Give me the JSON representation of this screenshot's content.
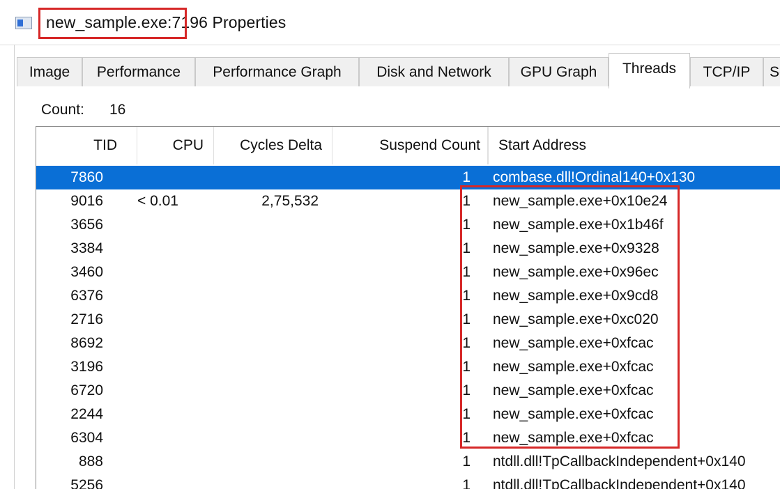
{
  "window": {
    "title": "new_sample.exe:7196 Properties"
  },
  "tabs": [
    {
      "label": "Image"
    },
    {
      "label": "Performance"
    },
    {
      "label": "Performance Graph"
    },
    {
      "label": "Disk and Network"
    },
    {
      "label": "GPU Graph"
    },
    {
      "label": "Threads",
      "active": true
    },
    {
      "label": "TCP/IP"
    },
    {
      "label": "Se"
    }
  ],
  "threads": {
    "count_label": "Count:",
    "count_value": "16",
    "columns": [
      "TID",
      "CPU",
      "Cycles Delta",
      "Suspend Count",
      "Start Address"
    ],
    "rows": [
      {
        "tid": "7860",
        "cpu": "",
        "cycles": "",
        "suspend": "1",
        "address": "combase.dll!Ordinal140+0x130",
        "selected": true
      },
      {
        "tid": "9016",
        "cpu": "< 0.01",
        "cycles": "2,75,532",
        "suspend": "1",
        "address": "new_sample.exe+0x10e24"
      },
      {
        "tid": "3656",
        "cpu": "",
        "cycles": "",
        "suspend": "1",
        "address": "new_sample.exe+0x1b46f"
      },
      {
        "tid": "3384",
        "cpu": "",
        "cycles": "",
        "suspend": "1",
        "address": "new_sample.exe+0x9328"
      },
      {
        "tid": "3460",
        "cpu": "",
        "cycles": "",
        "suspend": "1",
        "address": "new_sample.exe+0x96ec"
      },
      {
        "tid": "6376",
        "cpu": "",
        "cycles": "",
        "suspend": "1",
        "address": "new_sample.exe+0x9cd8"
      },
      {
        "tid": "2716",
        "cpu": "",
        "cycles": "",
        "suspend": "1",
        "address": "new_sample.exe+0xc020"
      },
      {
        "tid": "8692",
        "cpu": "",
        "cycles": "",
        "suspend": "1",
        "address": "new_sample.exe+0xfcac"
      },
      {
        "tid": "3196",
        "cpu": "",
        "cycles": "",
        "suspend": "1",
        "address": "new_sample.exe+0xfcac"
      },
      {
        "tid": "6720",
        "cpu": "",
        "cycles": "",
        "suspend": "1",
        "address": "new_sample.exe+0xfcac"
      },
      {
        "tid": "2244",
        "cpu": "",
        "cycles": "",
        "suspend": "1",
        "address": "new_sample.exe+0xfcac"
      },
      {
        "tid": "6304",
        "cpu": "",
        "cycles": "",
        "suspend": "1",
        "address": "new_sample.exe+0xfcac"
      },
      {
        "tid": "888",
        "cpu": "",
        "cycles": "",
        "suspend": "1",
        "address": "ntdll.dll!TpCallbackIndependent+0x140"
      },
      {
        "tid": "5256",
        "cpu": "",
        "cycles": "",
        "suspend": "1",
        "address": "ntdll.dll!TpCallbackIndependent+0x140"
      }
    ]
  },
  "colors": {
    "selection": "#0a6fd6",
    "highlight_box": "#d62828"
  }
}
